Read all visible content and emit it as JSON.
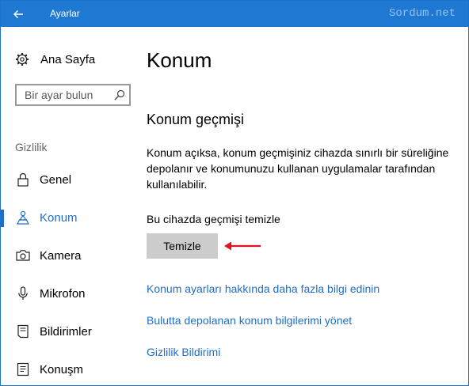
{
  "window": {
    "title": "Ayarlar",
    "watermark": "Sordum.net",
    "back_icon": "arrow-left-icon"
  },
  "sidebar": {
    "home": {
      "label": "Ana Sayfa",
      "icon": "gear-icon"
    },
    "search": {
      "placeholder": "Bir ayar bulun",
      "icon": "search-icon"
    },
    "section_label": "Gizlilik",
    "items": [
      {
        "label": "Genel",
        "icon": "lock-icon",
        "selected": false
      },
      {
        "label": "Konum",
        "icon": "location-person-icon",
        "selected": true
      },
      {
        "label": "Kamera",
        "icon": "camera-icon",
        "selected": false
      },
      {
        "label": "Mikrofon",
        "icon": "microphone-icon",
        "selected": false
      },
      {
        "label": "Bildirimler",
        "icon": "notifications-icon",
        "selected": false
      },
      {
        "label": "Konuşm",
        "icon": "speech-icon",
        "selected": false
      }
    ]
  },
  "main": {
    "page_title": "Konum",
    "section_title": "Konum geçmişi",
    "description": "Konum açıksa, konum geçmişiniz cihazda sınırlı bir süreliğine depolanır ve konumunuzu kullanan uygulamalar tarafından kullanılabilir.",
    "clear_label": "Bu cihazda geçmişi temizle",
    "clear_button": "Temizle",
    "links": [
      "Konum ayarları hakkında daha fazla bilgi edinin",
      "Bulutta depolanan konum bilgilerimi yönet",
      "Gizlilik Bildirimi"
    ]
  },
  "colors": {
    "titlebar": "#1f78d1",
    "accent": "#1f6fc9",
    "button_bg": "#cccccc",
    "annotation_arrow": "#e0141e"
  }
}
